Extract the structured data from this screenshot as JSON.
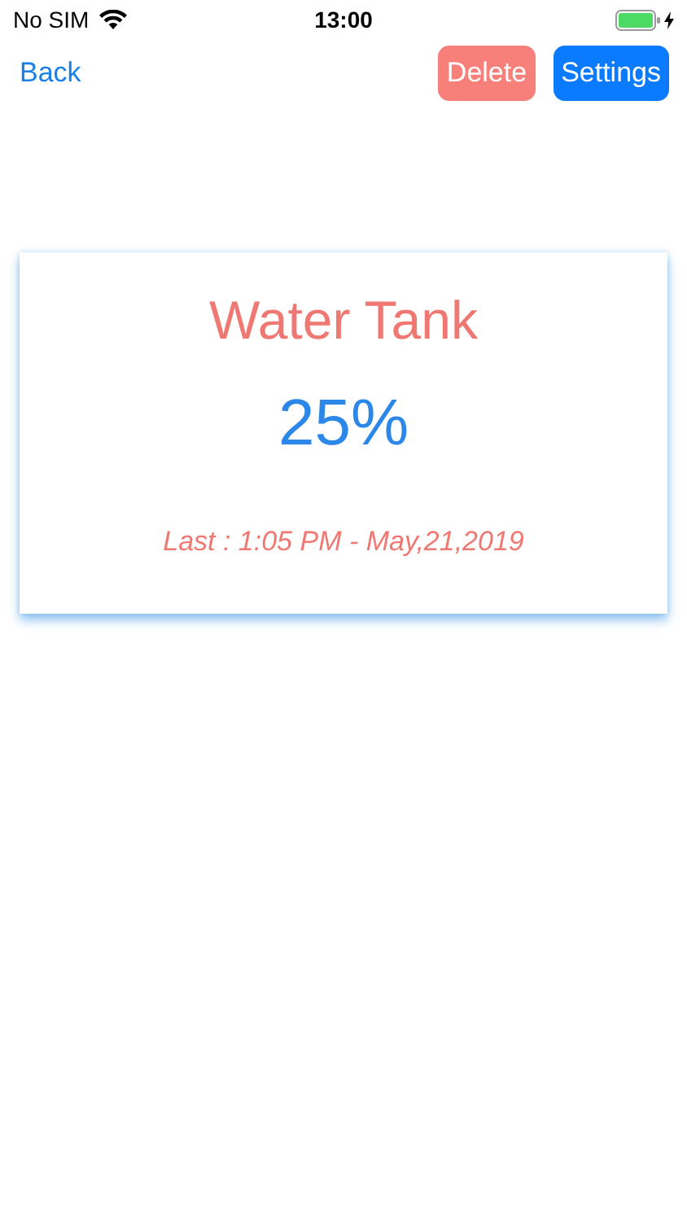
{
  "status_bar": {
    "carrier": "No SIM",
    "time": "13:00"
  },
  "nav": {
    "back": "Back",
    "buttons": [
      {
        "label": "Delete",
        "kind": "danger"
      },
      {
        "label": "Settings",
        "kind": "primary"
      }
    ]
  },
  "card": {
    "title": "Water Tank",
    "value": "25%",
    "last_update": "Last : 1:05 PM - May,21,2019"
  }
}
